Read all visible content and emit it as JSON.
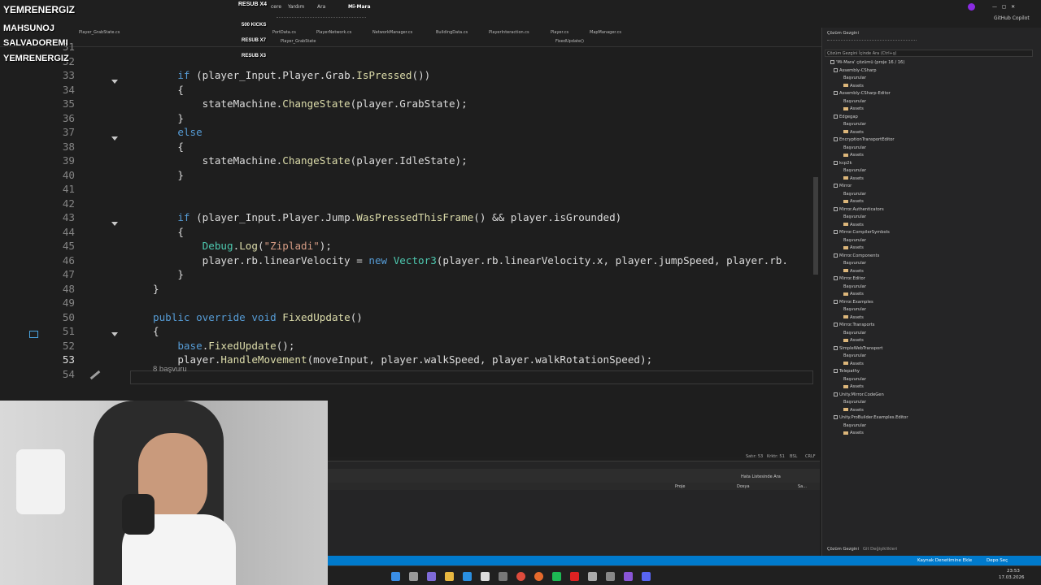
{
  "overlay": {
    "names": [
      "YEMRENERGIZ",
      "MAHSUNOJ",
      "SALVADOREMI",
      "YEMRENERGIZ"
    ],
    "resubs": [
      "RESUB X4",
      "RESUB X7",
      "RESUB X3"
    ],
    "kicks": "500 KICKS"
  },
  "menubar": {
    "items": [
      "cere",
      "Yardım",
      "Ara",
      "Mi-Mara"
    ],
    "copilot": "GitHub Copilot"
  },
  "tabs": [
    "Player_GrabState.cs",
    "PortData.cs",
    "PlayerNetwork.cs",
    "NetworkManager.cs",
    "BuildingData.cs",
    "PlayerInteraction.cs",
    "Player.cs",
    "MapManager.cs"
  ],
  "nav": {
    "left": "Player_GrabState",
    "right": "FixedUpdate()"
  },
  "editor": {
    "references": "8 başvuru",
    "lines": [
      {
        "n": "31",
        "code": ""
      },
      {
        "n": "32",
        "code": ""
      },
      {
        "n": "33",
        "code": "        if (player_Input.Player.Grab.IsPressed())"
      },
      {
        "n": "34",
        "code": "        {"
      },
      {
        "n": "35",
        "code": "            stateMachine.ChangeState(player.GrabState);"
      },
      {
        "n": "36",
        "code": "        }"
      },
      {
        "n": "37",
        "code": "        else"
      },
      {
        "n": "38",
        "code": "        {"
      },
      {
        "n": "39",
        "code": "            stateMachine.ChangeState(player.IdleState);"
      },
      {
        "n": "40",
        "code": "        }"
      },
      {
        "n": "41",
        "code": ""
      },
      {
        "n": "42",
        "code": ""
      },
      {
        "n": "43",
        "code": "        if (player_Input.Player.Jump.WasPressedThisFrame() && player.isGrounded)"
      },
      {
        "n": "44",
        "code": "        {"
      },
      {
        "n": "45",
        "code": "            Debug.Log(\"Zipladi\");"
      },
      {
        "n": "46",
        "code": "            player.rb.linearVelocity = new Vector3(player.rb.linearVelocity.x, player.jumpSpeed, player.rb."
      },
      {
        "n": "47",
        "code": "        }"
      },
      {
        "n": "48",
        "code": "    }"
      },
      {
        "n": "49",
        "code": ""
      },
      {
        "n": "50",
        "code": "    public override void FixedUpdate()"
      },
      {
        "n": "51",
        "code": "    {"
      },
      {
        "n": "52",
        "code": "        base.FixedUpdate();"
      },
      {
        "n": "53",
        "code": "        player.HandleMovement(moveInput, player.walkSpeed, player.walkRotationSpeed);"
      },
      {
        "n": "54",
        "code": ""
      }
    ],
    "status": {
      "line": "Satır: 53",
      "char": "Krktr: 51",
      "mode": "BSL",
      "eol": "CRLF"
    }
  },
  "errorlist": {
    "search": "Hata Listesinde Ara",
    "col_project": "Proje",
    "col_file": "Dosya",
    "col_line": "Sa..."
  },
  "solution": {
    "title": "Çözüm Gezgini",
    "search": "Çözüm Gezgini İçinde Ara (Ctrl+ş)",
    "root": "'Mi-Mara' çözümü (proje 16 / 16)",
    "projects": [
      "Assembly-CSharp",
      "Assembly-CSharp-Editor",
      "Edgegap",
      "EncryptionTransportEditor",
      "kcp2k",
      "Mirror",
      "Mirror.Authenticators",
      "Mirror.CompilerSymbols",
      "Mirror.Components",
      "Mirror.Editor",
      "Mirror.Examples",
      "Mirror.Transports",
      "SimpleWebTransport",
      "Telepathy",
      "Unity.Mirror.CodeGen",
      "Unity.ProBuilder.Examples.Editor"
    ],
    "refs_label": "Başvurular",
    "assets_label": "Assets",
    "bottom_tabs": [
      "Çözüm Gezgini",
      "Git Değişiklikleri"
    ]
  },
  "statusbar": {
    "left": "Kaynak Denetimine Ekle",
    "right": "Depo Seç"
  },
  "clock": {
    "time": "23:53",
    "date": "17.03.2026"
  },
  "colors": {
    "accent": "#007acc",
    "keyword": "#569cd6",
    "type": "#4ec9b0",
    "method": "#dcdcaa",
    "string": "#d69d85"
  }
}
